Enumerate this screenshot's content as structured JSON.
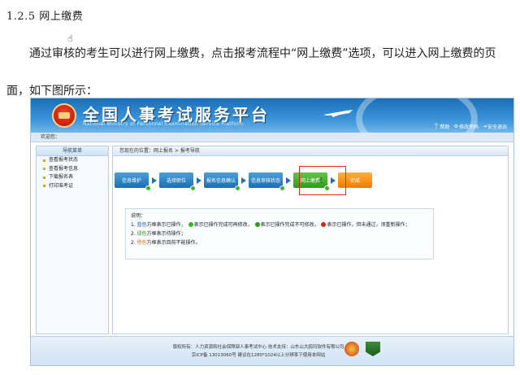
{
  "doc": {
    "heading": "1.2.5 网上缴费",
    "paragraph": "通过审核的考生可以进行网上缴费，点击报考流程中“网上缴费”选项，可以进入网上缴费的页面，如下图所示："
  },
  "portal": {
    "title": "全国人事考试服务平台",
    "subtitle": "National Ministry of Personnel Examination Service Platform",
    "top_links": [
      "帮助",
      "修改密码",
      "安全退出"
    ],
    "welcome": "欢迎您：",
    "sidebar": {
      "header": "导航菜单",
      "items": [
        "查看报考状态",
        "查看报考信息",
        "下载报名表",
        "打印准考证"
      ]
    },
    "breadcrumb": "您现在的位置：网上报名 > 报考导航",
    "steps": [
      {
        "label": "信息维护",
        "color": "blue"
      },
      {
        "label": "选择职位",
        "color": "blue"
      },
      {
        "label": "报名信息确认",
        "color": "blue"
      },
      {
        "label": "信息审核状态",
        "color": "blue"
      },
      {
        "label": "网上缴费",
        "color": "green"
      },
      {
        "label": "完成",
        "color": "orange"
      }
    ],
    "notes": {
      "title": "说明：",
      "line1_prefix": "1.",
      "line1_blue": "蓝色",
      "line1_a": "方框表示已操作，",
      "line1_b": "表示已操作完成可再修改，",
      "line1_c": "表示已操作完成不可修改，",
      "line1_d": "表示已操作，但未通过，须重新操作；",
      "line2_prefix": "2.",
      "line2_green": "绿色",
      "line2_text": "方框表示待操作；",
      "line3_prefix": "2.",
      "line3_orange": "橙色",
      "line3_text": "方框表示目前不能操作。"
    },
    "footer": {
      "line1": "版权所有：人力资源和社会保障部人事考试中心  技术支持：山东山大鸥玛软件有限公司",
      "line2": "京ICP备 13013060号  建议在1280*1024以上分辨率下使用本网站"
    },
    "colors": {
      "blue": "#1c6eb1",
      "green": "#2f9a1c",
      "orange": "#ee7a05",
      "highlight": "#e3281c"
    }
  }
}
